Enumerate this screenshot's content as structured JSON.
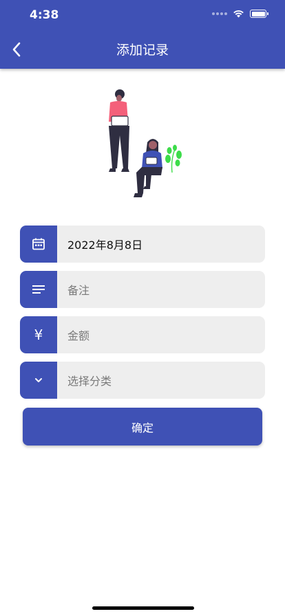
{
  "status_bar": {
    "time": "4:38"
  },
  "header": {
    "title": "添加记录",
    "back_icon": "chevron-left-icon"
  },
  "form": {
    "date": {
      "icon": "calendar-icon",
      "value": "2022年8月8日"
    },
    "note": {
      "icon": "notes-icon",
      "placeholder": "备注"
    },
    "amount": {
      "icon": "yen-icon",
      "symbol": "¥",
      "placeholder": "金额"
    },
    "category": {
      "icon": "chevron-down-icon",
      "placeholder": "选择分类"
    }
  },
  "confirm_label": "确定",
  "colors": {
    "primary": "#3f51b5",
    "field_bg": "#eeeeee",
    "plant": "#3ddc4a",
    "shirt": "#f4607a"
  }
}
